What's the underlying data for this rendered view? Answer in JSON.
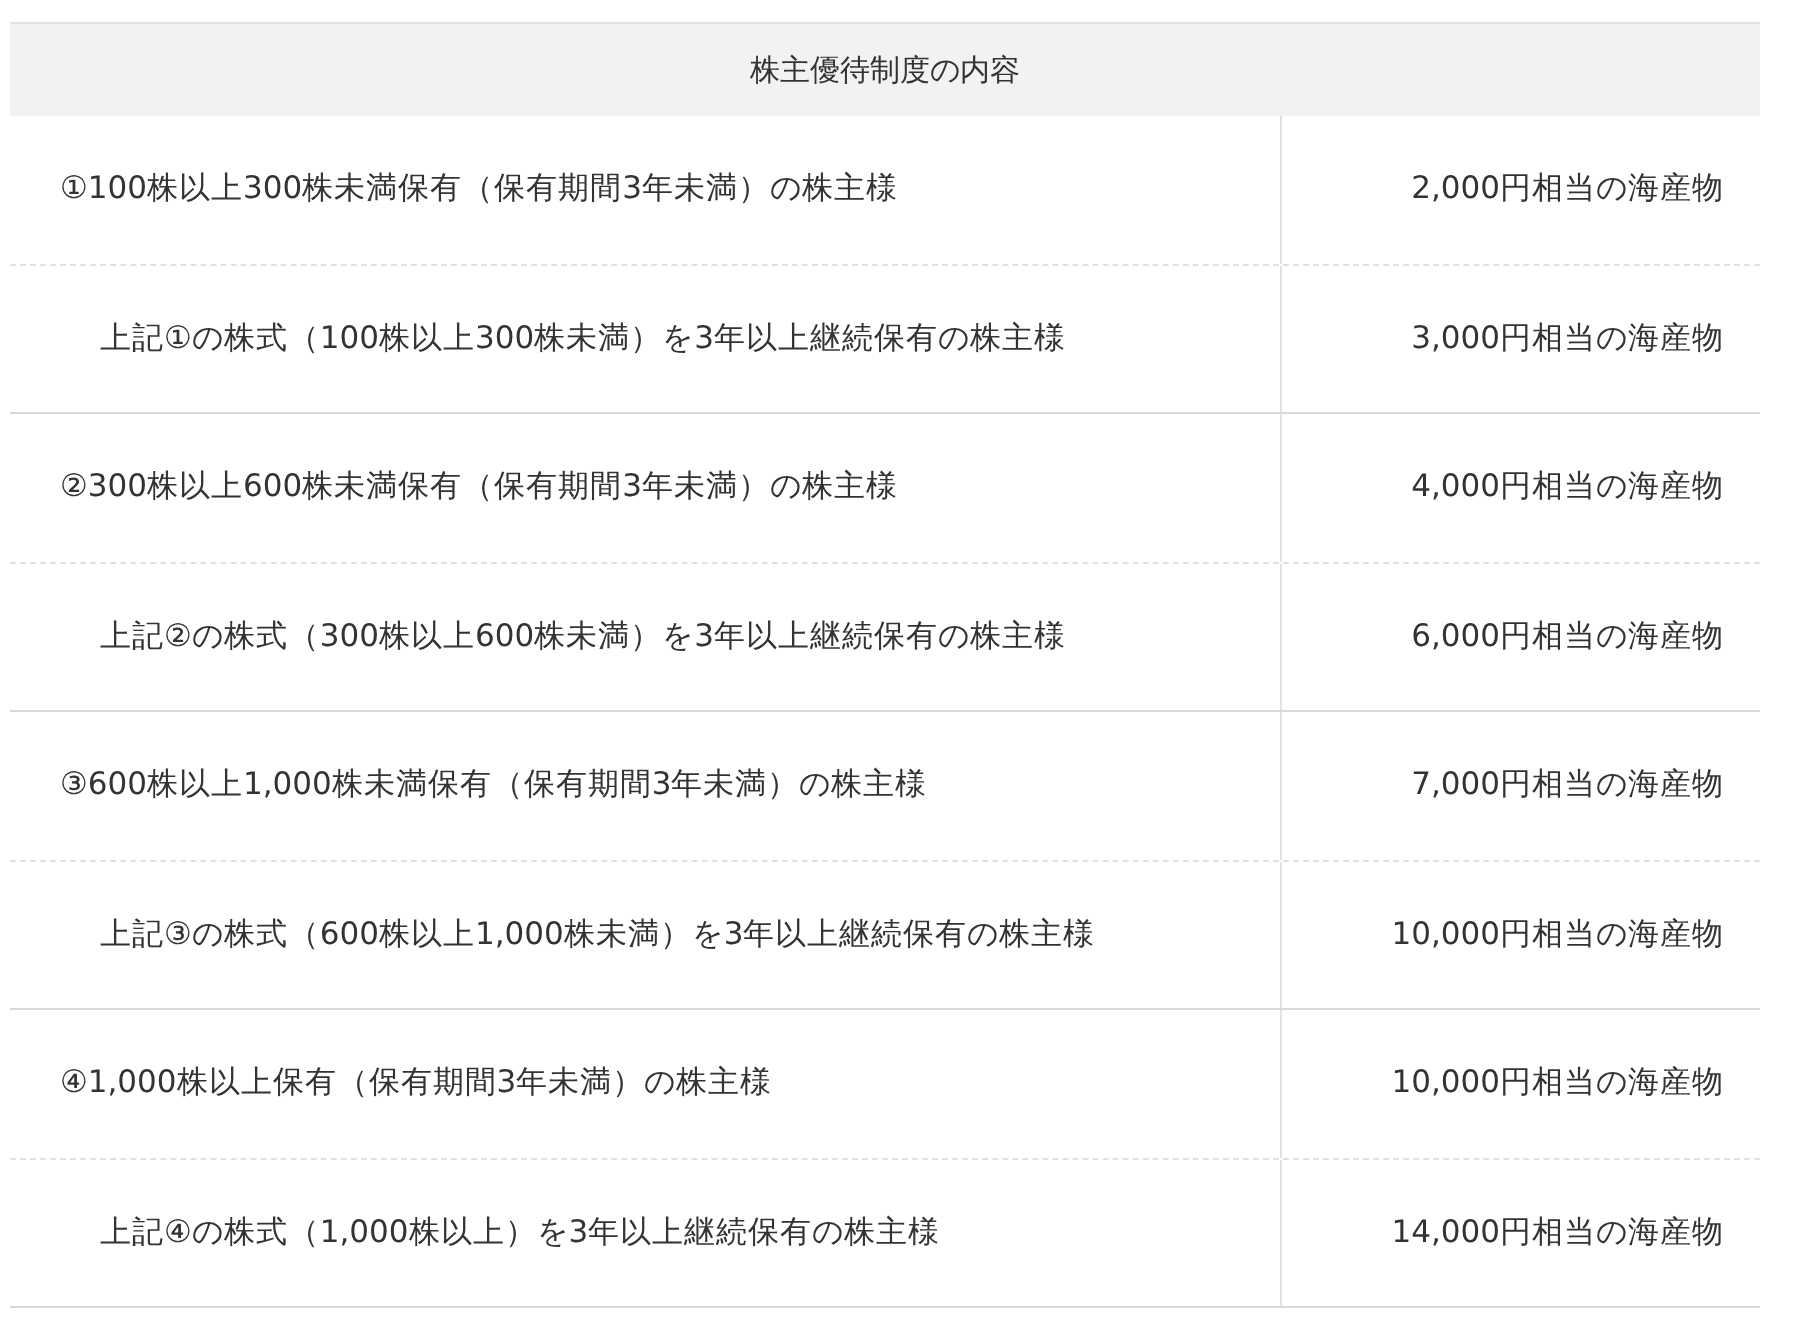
{
  "table": {
    "header": "株主優待制度の内容",
    "rows": [
      {
        "kind": "main",
        "condition": "①100株以上300株未満保有（保有期間3年未満）の株主様",
        "benefit": "2,000円相当の海産物"
      },
      {
        "kind": "sub",
        "condition": "上記①の株式（100株以上300株未満）を3年以上継続保有の株主様",
        "benefit": "3,000円相当の海産物"
      },
      {
        "kind": "main",
        "condition": "②300株以上600株未満保有（保有期間3年未満）の株主様",
        "benefit": "4,000円相当の海産物"
      },
      {
        "kind": "sub",
        "condition": "上記②の株式（300株以上600株未満）を3年以上継続保有の株主様",
        "benefit": "6,000円相当の海産物"
      },
      {
        "kind": "main",
        "condition": "③600株以上1,000株未満保有（保有期間3年未満）の株主様",
        "benefit": "7,000円相当の海産物"
      },
      {
        "kind": "sub",
        "condition": "上記③の株式（600株以上1,000株未満）を3年以上継続保有の株主様",
        "benefit": "10,000円相当の海産物"
      },
      {
        "kind": "main",
        "condition": "④1,000株以上保有（保有期間3年未満）の株主様",
        "benefit": "10,000円相当の海産物"
      },
      {
        "kind": "sub",
        "condition": "上記④の株式（1,000株以上）を3年以上継続保有の株主様",
        "benefit": "14,000円相当の海産物"
      }
    ]
  }
}
